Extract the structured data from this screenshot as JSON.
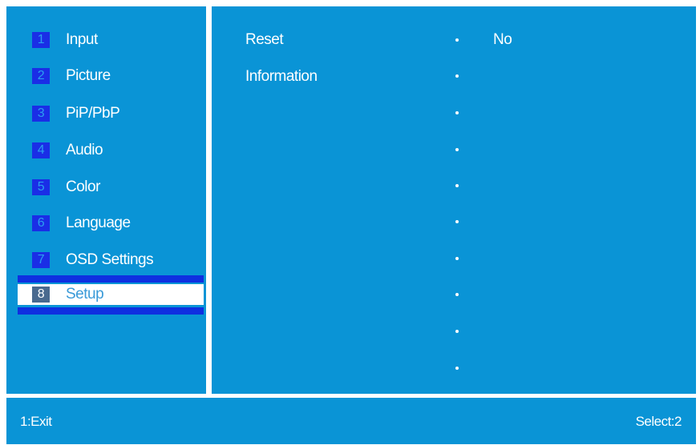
{
  "menu": {
    "items": [
      {
        "num": "1",
        "label": "Input"
      },
      {
        "num": "2",
        "label": "Picture"
      },
      {
        "num": "3",
        "label": "PiP/PbP"
      },
      {
        "num": "4",
        "label": "Audio"
      },
      {
        "num": "5",
        "label": "Color"
      },
      {
        "num": "6",
        "label": "Language"
      },
      {
        "num": "7",
        "label": "OSD Settings"
      },
      {
        "num": "8",
        "label": "Setup"
      }
    ],
    "selected_index": 8
  },
  "setup": {
    "rows": [
      {
        "label": "Reset",
        "value": "No"
      },
      {
        "label": "Information",
        "value": ""
      }
    ]
  },
  "footer": {
    "left": "1:Exit",
    "right": "Select:2"
  },
  "colors": {
    "panel_bg": "#0a94d6",
    "selection_bar": "#0f2fe0",
    "number_box": "#1a2ee6"
  }
}
